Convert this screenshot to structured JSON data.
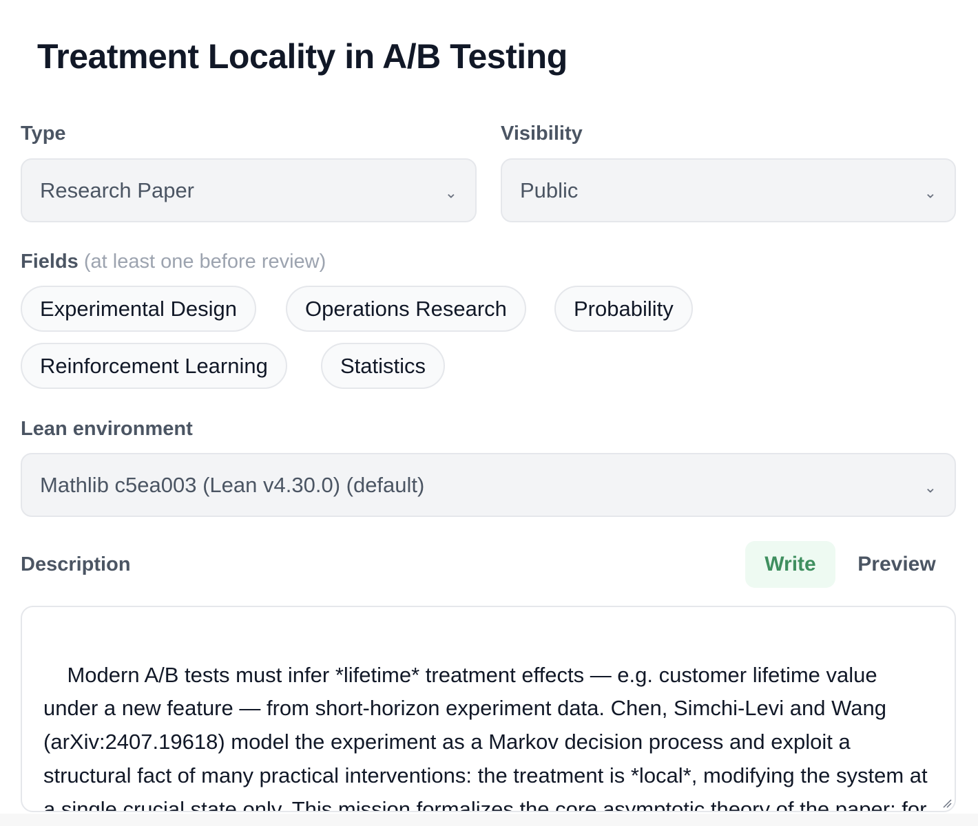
{
  "page": {
    "title": "Treatment Locality in A/B Testing"
  },
  "type_field": {
    "label": "Type",
    "value": "Research Paper"
  },
  "visibility_field": {
    "label": "Visibility",
    "value": "Public"
  },
  "fields": {
    "label": "Fields",
    "hint": "(at least one before review)",
    "chips": [
      "Experimental Design",
      "Operations Research",
      "Probability",
      "Reinforcement Learning",
      "Statistics"
    ]
  },
  "lean_env": {
    "label": "Lean environment",
    "value": "Mathlib c5ea003 (Lean v4.30.0) (default)"
  },
  "description": {
    "label": "Description",
    "tabs": {
      "write": "Write",
      "preview": "Preview",
      "active": "write"
    },
    "text": "Modern A/B tests must infer *lifetime* treatment effects — e.g. customer lifetime value under a new feature — from short-horizon experiment data. Chen, Simchi-Levi and Wang (arXiv:2407.19618) model the experiment as a Markov decision process and exploit a structural fact of many practical interventions: the treatment is *local*, modifying the system at a single crucial state only. This mission formalizes the core asymptotic theory of the paper: for **any** differentiable estimator built"
  },
  "icons": {
    "select_chevron": "chevron-down-icon",
    "resize_handle": "resize-handle-icon"
  },
  "colors": {
    "active_tab_bg": "#eefaf2",
    "active_tab_text": "#3f8f5f",
    "field_bg": "#f3f4f6"
  }
}
